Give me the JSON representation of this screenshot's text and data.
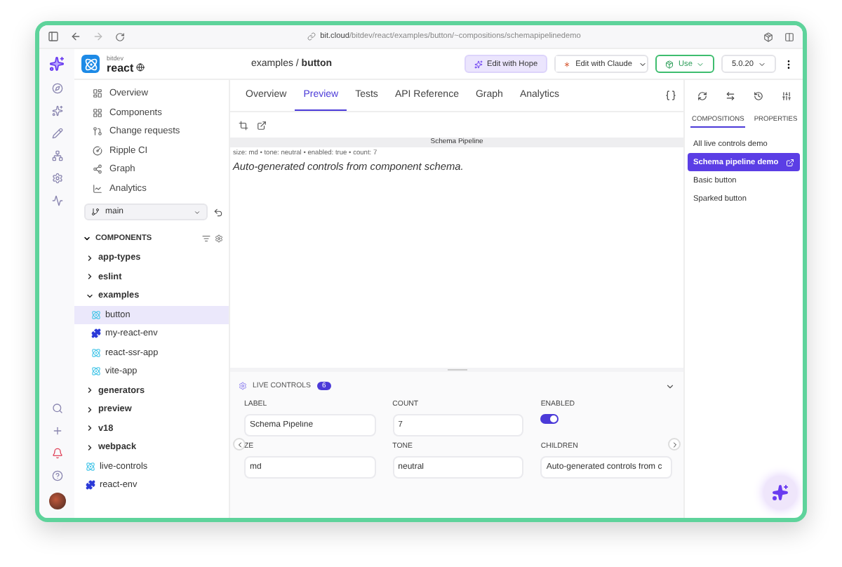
{
  "browser": {
    "url_host": "bit.cloud",
    "url_path": "/bitdev/react/examples/button/~compositions/schemapipelinedemo"
  },
  "header": {
    "org": "bitdev",
    "scope": "react",
    "breadcrumb": "examples / **button**",
    "hope_button": "Edit with Hope",
    "claude_button": "Edit with Claude",
    "use_button": "Use",
    "version": "5.0.20"
  },
  "sidebar": {
    "nav": [
      {
        "label": "Overview",
        "kind": "overview"
      },
      {
        "label": "Components",
        "kind": "components"
      },
      {
        "label": "Change requests",
        "kind": "requests"
      },
      {
        "label": "Ripple CI",
        "kind": "ci"
      },
      {
        "label": "Graph",
        "kind": "graph"
      },
      {
        "label": "Analytics",
        "kind": "analytics"
      }
    ],
    "branch": "main",
    "components_title": "COMPONENTS",
    "tree": [
      {
        "label": "app-types",
        "kind": "folder",
        "expanded": false,
        "selected": false
      },
      {
        "label": "eslint",
        "kind": "folder",
        "expanded": false,
        "selected": false
      },
      {
        "label": "examples",
        "kind": "folder",
        "expanded": true,
        "selected": false,
        "children": [
          {
            "label": "button",
            "kind": "component",
            "selected": true
          },
          {
            "label": "my-react-env",
            "kind": "env",
            "selected": false
          },
          {
            "label": "react-ssr-app",
            "kind": "component",
            "selected": false
          },
          {
            "label": "vite-app",
            "kind": "component",
            "selected": false
          }
        ]
      },
      {
        "label": "generators",
        "kind": "folder",
        "expanded": false,
        "selected": false
      },
      {
        "label": "preview",
        "kind": "folder",
        "expanded": false,
        "selected": false
      },
      {
        "label": "v18",
        "kind": "folder",
        "expanded": false,
        "selected": false
      },
      {
        "label": "webpack",
        "kind": "folder",
        "expanded": false,
        "selected": false
      },
      {
        "label": "live-controls",
        "kind": "component",
        "selected": false
      },
      {
        "label": "react-env",
        "kind": "env",
        "selected": false
      }
    ]
  },
  "tabs": [
    {
      "label": "Overview",
      "selected": false
    },
    {
      "label": "Preview",
      "selected": true
    },
    {
      "label": "Tests",
      "selected": false
    },
    {
      "label": "API Reference",
      "selected": false
    },
    {
      "label": "Graph",
      "selected": false
    },
    {
      "label": "Analytics",
      "selected": false
    }
  ],
  "preview": {
    "title": "Schema Pipeline",
    "props_line": "size: md • tone: neutral • enabled: true • count: 7",
    "description": "Auto-generated controls from component schema."
  },
  "live_controls": {
    "title": "LIVE CONTROLS",
    "count": "6",
    "fields": [
      {
        "label": "LABEL",
        "kind": "text",
        "value": "Schema Pipeline"
      },
      {
        "label": "COUNT",
        "kind": "text",
        "value": "7"
      },
      {
        "label": "ENABLED",
        "kind": "toggle",
        "on": true
      },
      {
        "label": "ZE",
        "kind": "text",
        "value": "md"
      },
      {
        "label": "TONE",
        "kind": "text",
        "value": "neutral"
      },
      {
        "label": "CHILDREN",
        "kind": "text",
        "value": "Auto-generated controls from c"
      }
    ]
  },
  "right_panel": {
    "tabs": [
      {
        "label": "COMPOSITIONS",
        "selected": true
      },
      {
        "label": "PROPERTIES",
        "selected": false
      }
    ],
    "compositions": [
      {
        "label": "All live controls demo",
        "selected": false
      },
      {
        "label": "Schema pipeline demo",
        "selected": true
      },
      {
        "label": "Basic button",
        "selected": false
      },
      {
        "label": "Sparked button",
        "selected": false
      }
    ]
  }
}
